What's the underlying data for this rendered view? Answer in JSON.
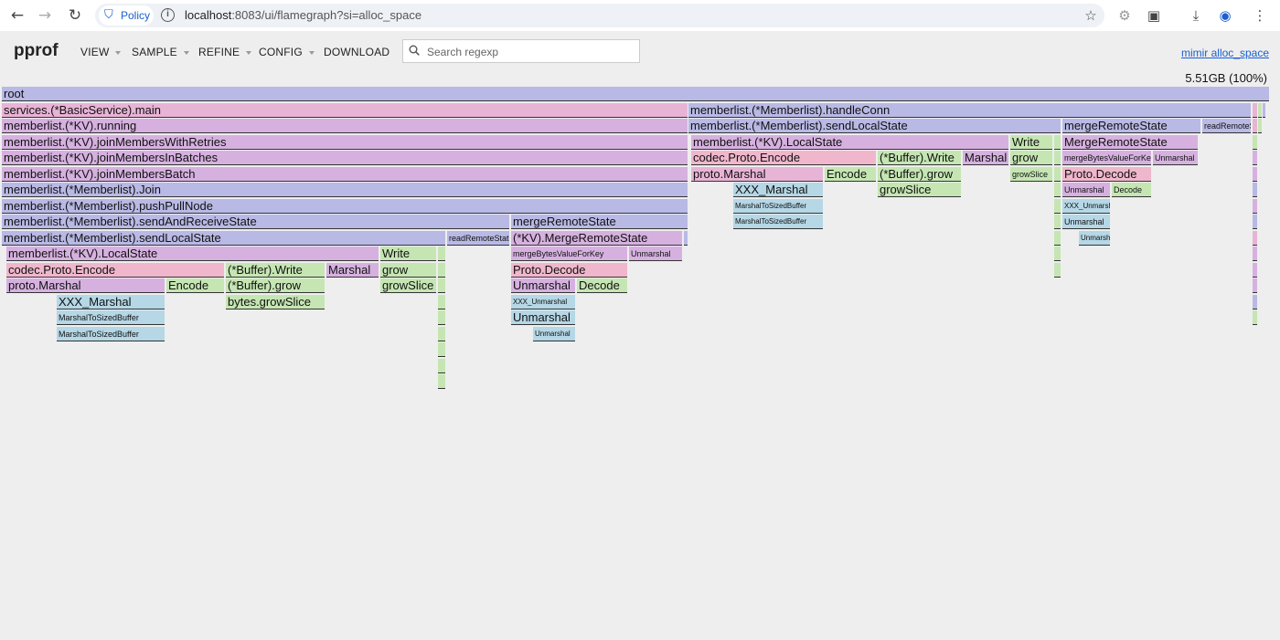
{
  "browser": {
    "policy_label": "Policy",
    "url_host": "localhost",
    "url_rest": ":8083/ui/flamegraph?si=alloc_space"
  },
  "header": {
    "logo": "pprof",
    "menus": [
      "VIEW",
      "SAMPLE",
      "REFINE",
      "CONFIG",
      "DOWNLOAD"
    ],
    "search_placeholder": "Search regexp",
    "profile_link": "mimir alloc_space",
    "total": "5.51GB (100%)"
  },
  "colors": {
    "purple": "#b9b9e6",
    "pink": "#e8b4d6",
    "green": "#c5e6b3",
    "blue": "#b5d7e6",
    "mauve": "#d6b1e0",
    "rose": "#f0b7cc"
  },
  "frames": [
    {
      "row": 0,
      "from": 2,
      "to": 1388,
      "label": "root",
      "c": "purple"
    },
    {
      "row": 1,
      "from": 2,
      "to": 752,
      "label": "services.(*BasicService).main",
      "c": "pink"
    },
    {
      "row": 1,
      "from": 753,
      "to": 1368,
      "label": "memberlist.(*Memberlist).handleConn",
      "c": "purple"
    },
    {
      "row": 1,
      "from": 1370,
      "to": 1375,
      "label": "",
      "c": "pink"
    },
    {
      "row": 1,
      "from": 1376,
      "to": 1380,
      "label": "",
      "c": "green"
    },
    {
      "row": 1,
      "from": 1381,
      "to": 1384,
      "label": "",
      "c": "purple"
    },
    {
      "row": 2,
      "from": 2,
      "to": 752,
      "label": "memberlist.(*KV).running",
      "c": "mauve"
    },
    {
      "row": 2,
      "from": 753,
      "to": 1160,
      "label": "memberlist.(*Memberlist).sendLocalState",
      "c": "purple"
    },
    {
      "row": 2,
      "from": 1162,
      "to": 1313,
      "label": "mergeRemoteState",
      "c": "purple"
    },
    {
      "row": 2,
      "from": 1315,
      "to": 1368,
      "label": "readRemoteState",
      "c": "purple",
      "size": "small"
    },
    {
      "row": 2,
      "from": 1370,
      "to": 1375,
      "label": "",
      "c": "pink"
    },
    {
      "row": 2,
      "from": 1376,
      "to": 1380,
      "label": "",
      "c": "green"
    },
    {
      "row": 3,
      "from": 2,
      "to": 752,
      "label": "memberlist.(*KV).joinMembersWithRetries",
      "c": "mauve"
    },
    {
      "row": 3,
      "from": 756,
      "to": 1103,
      "label": "memberlist.(*KV).LocalState",
      "c": "mauve"
    },
    {
      "row": 3,
      "from": 1105,
      "to": 1151,
      "label": "Write",
      "c": "green"
    },
    {
      "row": 3,
      "from": 1153,
      "to": 1160,
      "label": "",
      "c": "green"
    },
    {
      "row": 3,
      "from": 1162,
      "to": 1310,
      "label": "MergeRemoteState",
      "c": "mauve"
    },
    {
      "row": 3,
      "from": 1370,
      "to": 1375,
      "label": "",
      "c": "green"
    },
    {
      "row": 4,
      "from": 2,
      "to": 752,
      "label": "memberlist.(*KV).joinMembersInBatches",
      "c": "mauve"
    },
    {
      "row": 4,
      "from": 756,
      "to": 958,
      "label": "codec.Proto.Encode",
      "c": "rose"
    },
    {
      "row": 4,
      "from": 960,
      "to": 1051,
      "label": "(*Buffer).Write",
      "c": "green"
    },
    {
      "row": 4,
      "from": 1053,
      "to": 1103,
      "label": "Marshal",
      "c": "mauve"
    },
    {
      "row": 4,
      "from": 1105,
      "to": 1151,
      "label": "grow",
      "c": "green"
    },
    {
      "row": 4,
      "from": 1153,
      "to": 1160,
      "label": "",
      "c": "green"
    },
    {
      "row": 4,
      "from": 1162,
      "to": 1259,
      "label": "mergeBytesValueForKey",
      "c": "mauve",
      "size": "small"
    },
    {
      "row": 4,
      "from": 1261,
      "to": 1310,
      "label": "Unmarshal",
      "c": "mauve",
      "size": "small"
    },
    {
      "row": 4,
      "from": 1370,
      "to": 1375,
      "label": "",
      "c": "mauve"
    },
    {
      "row": 5,
      "from": 2,
      "to": 752,
      "label": "memberlist.(*KV).joinMembersBatch",
      "c": "mauve"
    },
    {
      "row": 5,
      "from": 756,
      "to": 900,
      "label": "proto.Marshal",
      "c": "pink"
    },
    {
      "row": 5,
      "from": 902,
      "to": 958,
      "label": "Encode",
      "c": "green"
    },
    {
      "row": 5,
      "from": 960,
      "to": 1051,
      "label": "(*Buffer).grow",
      "c": "green"
    },
    {
      "row": 5,
      "from": 1105,
      "to": 1151,
      "label": "growSlice",
      "c": "green",
      "size": "small"
    },
    {
      "row": 5,
      "from": 1153,
      "to": 1160,
      "label": "",
      "c": "green"
    },
    {
      "row": 5,
      "from": 1162,
      "to": 1259,
      "label": "Proto.Decode",
      "c": "rose"
    },
    {
      "row": 5,
      "from": 1370,
      "to": 1375,
      "label": "",
      "c": "mauve"
    },
    {
      "row": 6,
      "from": 2,
      "to": 752,
      "label": "memberlist.(*Memberlist).Join",
      "c": "purple"
    },
    {
      "row": 6,
      "from": 802,
      "to": 900,
      "label": "XXX_Marshal",
      "c": "blue"
    },
    {
      "row": 6,
      "from": 960,
      "to": 1051,
      "label": "growSlice",
      "c": "green"
    },
    {
      "row": 6,
      "from": 1153,
      "to": 1160,
      "label": "",
      "c": "green"
    },
    {
      "row": 6,
      "from": 1162,
      "to": 1214,
      "label": "Unmarshal",
      "c": "mauve",
      "size": "small"
    },
    {
      "row": 6,
      "from": 1216,
      "to": 1259,
      "label": "Decode",
      "c": "green",
      "size": "small"
    },
    {
      "row": 6,
      "from": 1370,
      "to": 1375,
      "label": "",
      "c": "purple"
    },
    {
      "row": 7,
      "from": 2,
      "to": 752,
      "label": "memberlist.(*Memberlist).pushPullNode",
      "c": "purple"
    },
    {
      "row": 7,
      "from": 802,
      "to": 900,
      "label": "MarshalToSizedBuffer",
      "c": "blue",
      "size": "tiny"
    },
    {
      "row": 7,
      "from": 1153,
      "to": 1160,
      "label": "",
      "c": "green"
    },
    {
      "row": 7,
      "from": 1162,
      "to": 1214,
      "label": "XXX_Unmarshal",
      "c": "blue",
      "size": "tiny"
    },
    {
      "row": 7,
      "from": 1370,
      "to": 1375,
      "label": "",
      "c": "mauve"
    },
    {
      "row": 8,
      "from": 2,
      "to": 557,
      "label": "memberlist.(*Memberlist).sendAndReceiveState",
      "c": "purple"
    },
    {
      "row": 8,
      "from": 559,
      "to": 752,
      "label": "mergeRemoteState",
      "c": "purple"
    },
    {
      "row": 8,
      "from": 802,
      "to": 900,
      "label": "MarshalToSizedBuffer",
      "c": "blue",
      "size": "tiny"
    },
    {
      "row": 8,
      "from": 1153,
      "to": 1160,
      "label": "",
      "c": "green"
    },
    {
      "row": 8,
      "from": 1162,
      "to": 1214,
      "label": "Unmarshal",
      "c": "blue",
      "size": "small"
    },
    {
      "row": 8,
      "from": 1370,
      "to": 1375,
      "label": "",
      "c": "purple"
    },
    {
      "row": 9,
      "from": 2,
      "to": 487,
      "label": "memberlist.(*Memberlist).sendLocalState",
      "c": "purple"
    },
    {
      "row": 9,
      "from": 489,
      "to": 557,
      "label": "readRemoteState",
      "c": "purple",
      "size": "small"
    },
    {
      "row": 9,
      "from": 559,
      "to": 746,
      "label": "(*KV).MergeRemoteState",
      "c": "mauve"
    },
    {
      "row": 9,
      "from": 748,
      "to": 752,
      "label": "",
      "c": "purple"
    },
    {
      "row": 9,
      "from": 1153,
      "to": 1160,
      "label": "",
      "c": "green"
    },
    {
      "row": 9,
      "from": 1180,
      "to": 1214,
      "label": "Unmarshal",
      "c": "blue",
      "size": "tiny"
    },
    {
      "row": 9,
      "from": 1370,
      "to": 1375,
      "label": "",
      "c": "pink"
    },
    {
      "row": 10,
      "from": 7,
      "to": 414,
      "label": "memberlist.(*KV).LocalState",
      "c": "mauve"
    },
    {
      "row": 10,
      "from": 416,
      "to": 477,
      "label": "Write",
      "c": "green"
    },
    {
      "row": 10,
      "from": 479,
      "to": 487,
      "label": "",
      "c": "green"
    },
    {
      "row": 10,
      "from": 559,
      "to": 686,
      "label": "mergeBytesValueForKey",
      "c": "mauve",
      "size": "small"
    },
    {
      "row": 10,
      "from": 688,
      "to": 746,
      "label": "Unmarshal",
      "c": "mauve",
      "size": "small"
    },
    {
      "row": 10,
      "from": 1153,
      "to": 1160,
      "label": "",
      "c": "green"
    },
    {
      "row": 10,
      "from": 1370,
      "to": 1375,
      "label": "",
      "c": "mauve"
    },
    {
      "row": 11,
      "from": 7,
      "to": 245,
      "label": "codec.Proto.Encode",
      "c": "rose"
    },
    {
      "row": 11,
      "from": 247,
      "to": 355,
      "label": "(*Buffer).Write",
      "c": "green"
    },
    {
      "row": 11,
      "from": 357,
      "to": 414,
      "label": "Marshal",
      "c": "mauve"
    },
    {
      "row": 11,
      "from": 416,
      "to": 477,
      "label": "grow",
      "c": "green"
    },
    {
      "row": 11,
      "from": 479,
      "to": 487,
      "label": "",
      "c": "green"
    },
    {
      "row": 11,
      "from": 559,
      "to": 686,
      "label": "Proto.Decode",
      "c": "rose"
    },
    {
      "row": 11,
      "from": 1153,
      "to": 1160,
      "label": "",
      "c": "green"
    },
    {
      "row": 11,
      "from": 1370,
      "to": 1375,
      "label": "",
      "c": "mauve"
    },
    {
      "row": 12,
      "from": 7,
      "to": 180,
      "label": "proto.Marshal",
      "c": "mauve"
    },
    {
      "row": 12,
      "from": 182,
      "to": 245,
      "label": "Encode",
      "c": "green"
    },
    {
      "row": 12,
      "from": 247,
      "to": 355,
      "label": "(*Buffer).grow",
      "c": "green"
    },
    {
      "row": 12,
      "from": 416,
      "to": 477,
      "label": "growSlice",
      "c": "green"
    },
    {
      "row": 12,
      "from": 479,
      "to": 487,
      "label": "",
      "c": "green"
    },
    {
      "row": 12,
      "from": 559,
      "to": 629,
      "label": "Unmarshal",
      "c": "mauve"
    },
    {
      "row": 12,
      "from": 631,
      "to": 686,
      "label": "Decode",
      "c": "green"
    },
    {
      "row": 12,
      "from": 1370,
      "to": 1375,
      "label": "",
      "c": "mauve"
    },
    {
      "row": 13,
      "from": 62,
      "to": 180,
      "label": "XXX_Marshal",
      "c": "blue"
    },
    {
      "row": 13,
      "from": 247,
      "to": 355,
      "label": "bytes.growSlice",
      "c": "green"
    },
    {
      "row": 13,
      "from": 479,
      "to": 487,
      "label": "",
      "c": "green"
    },
    {
      "row": 13,
      "from": 559,
      "to": 629,
      "label": "XXX_Unmarshal",
      "c": "blue",
      "size": "tiny"
    },
    {
      "row": 13,
      "from": 1370,
      "to": 1375,
      "label": "",
      "c": "purple"
    },
    {
      "row": 14,
      "from": 62,
      "to": 180,
      "label": "MarshalToSizedBuffer",
      "c": "blue",
      "size": "small"
    },
    {
      "row": 14,
      "from": 479,
      "to": 487,
      "label": "",
      "c": "green"
    },
    {
      "row": 14,
      "from": 559,
      "to": 629,
      "label": "Unmarshal",
      "c": "blue"
    },
    {
      "row": 14,
      "from": 1370,
      "to": 1375,
      "label": "",
      "c": "green"
    },
    {
      "row": 15,
      "from": 62,
      "to": 180,
      "label": "MarshalToSizedBuffer",
      "c": "blue",
      "size": "small"
    },
    {
      "row": 15,
      "from": 479,
      "to": 487,
      "label": "",
      "c": "green"
    },
    {
      "row": 15,
      "from": 583,
      "to": 629,
      "label": "Unmarshal",
      "c": "blue",
      "size": "tiny"
    },
    {
      "row": 16,
      "from": 479,
      "to": 487,
      "label": "",
      "c": "green"
    },
    {
      "row": 17,
      "from": 479,
      "to": 487,
      "label": "",
      "c": "green"
    },
    {
      "row": 18,
      "from": 479,
      "to": 487,
      "label": "",
      "c": "green"
    }
  ]
}
